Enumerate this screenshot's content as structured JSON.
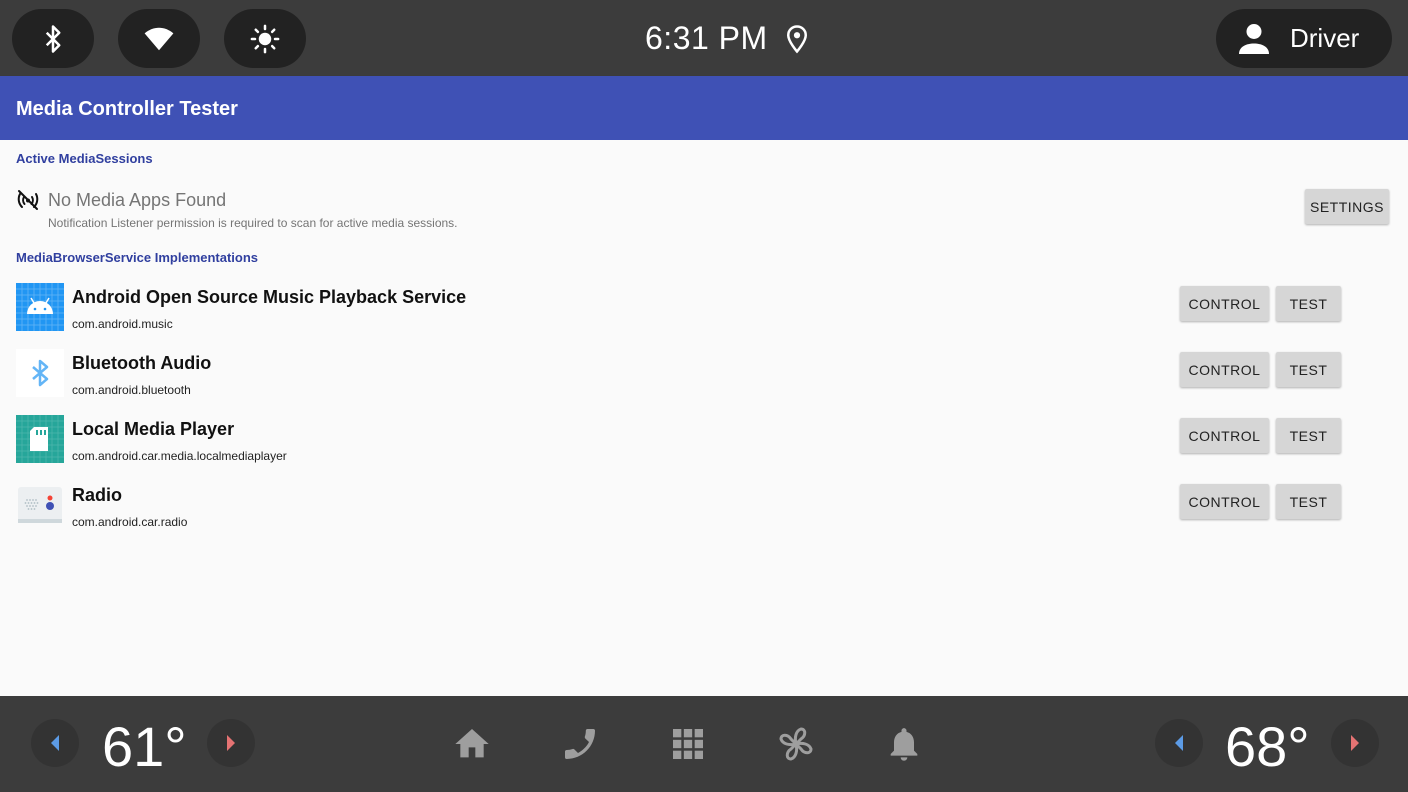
{
  "status_bar": {
    "clock": "6:31 PM",
    "user_label": "Driver",
    "icons": [
      "bluetooth-icon",
      "wifi-icon",
      "brightness-icon",
      "location-icon",
      "person-icon"
    ]
  },
  "app_bar": {
    "title": "Media Controller Tester",
    "color": "#3f51b5"
  },
  "active_sessions": {
    "header": "Active MediaSessions",
    "empty_title": "No Media Apps Found",
    "empty_subtitle": "Notification Listener permission is required to scan for active media sessions.",
    "settings_label": "SETTINGS"
  },
  "browser_services": {
    "header": "MediaBrowserService Implementations",
    "control_label": "CONTROL",
    "test_label": "TEST",
    "items": [
      {
        "title": "Android Open Source Music Playback Service",
        "package": "com.android.music",
        "icon": "android-icon"
      },
      {
        "title": "Bluetooth Audio",
        "package": "com.android.bluetooth",
        "icon": "bluetooth-icon"
      },
      {
        "title": "Local Media Player",
        "package": "com.android.car.media.localmediaplayer",
        "icon": "sd-card-icon"
      },
      {
        "title": "Radio",
        "package": "com.android.car.radio",
        "icon": "radio-icon"
      }
    ]
  },
  "nav_bar": {
    "left_temp": "61°",
    "right_temp": "68°",
    "icons": [
      "home-icon",
      "phone-icon",
      "apps-grid-icon",
      "fan-icon",
      "bell-icon"
    ]
  }
}
